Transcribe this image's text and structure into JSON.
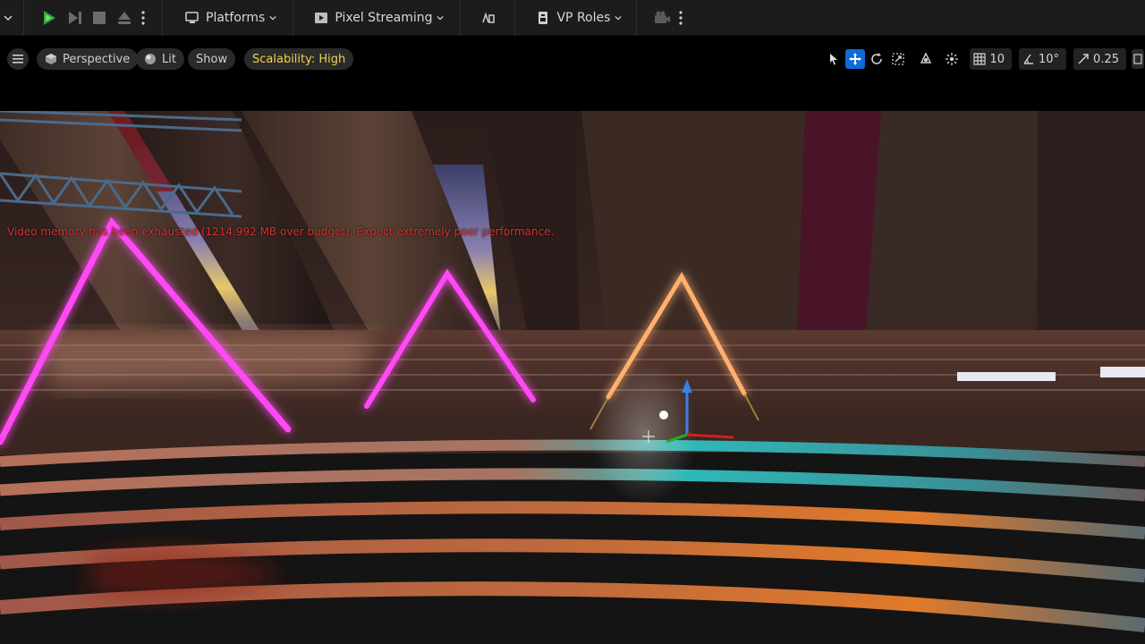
{
  "toolbar": {
    "platforms_label": "Platforms",
    "pixel_streaming_label": "Pixel Streaming",
    "vp_roles_label": "VP Roles"
  },
  "viewport_toolbar": {
    "perspective_label": "Perspective",
    "lit_label": "Lit",
    "show_label": "Show",
    "scalability_label": "Scalability: High",
    "grid_snap_value": "10",
    "rotation_snap_value": "10°",
    "scale_snap_value": "0.25"
  },
  "viewport": {
    "warning_text": "Video memory has been exhausted (1214.992 MB over budget). Expect extremely poor performance."
  },
  "colors": {
    "play_green": "#2fa832",
    "accent_blue": "#0f6ad8",
    "scalability_yellow": "#f0d24a",
    "warning_red": "#d33333",
    "neon_magenta": "#ff3cf2",
    "neon_orange": "#ffb070",
    "floor_cyan": "#2fd8d8"
  }
}
